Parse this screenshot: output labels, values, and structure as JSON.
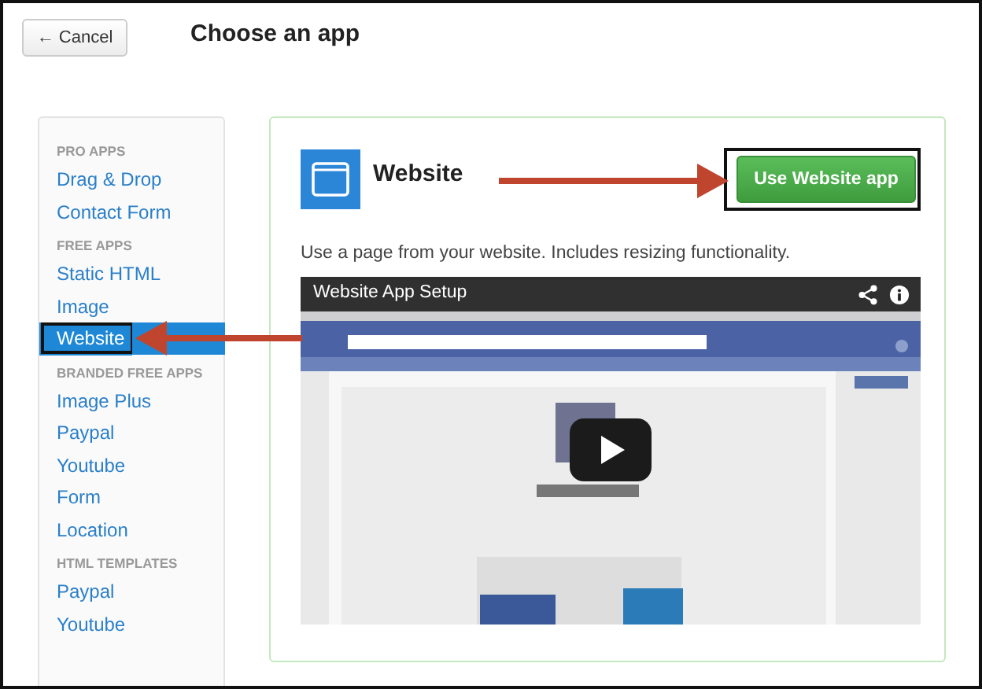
{
  "header": {
    "cancel_button": "← Cancel",
    "title": "Choose an app"
  },
  "sidebar": {
    "sections": [
      {
        "heading": "PRO APPS",
        "items": [
          {
            "label": "Drag & Drop",
            "selected": false
          },
          {
            "label": "Contact Form",
            "selected": false
          }
        ]
      },
      {
        "heading": "FREE APPS",
        "items": [
          {
            "label": "Static HTML",
            "selected": false
          },
          {
            "label": "Image",
            "selected": false
          },
          {
            "label": "Website",
            "selected": true
          }
        ]
      },
      {
        "heading": "BRANDED FREE APPS",
        "items": [
          {
            "label": "Image Plus",
            "selected": false
          },
          {
            "label": "Paypal",
            "selected": false
          },
          {
            "label": "Youtube",
            "selected": false
          },
          {
            "label": "Form",
            "selected": false
          },
          {
            "label": "Location",
            "selected": false
          }
        ]
      },
      {
        "heading": "HTML TEMPLATES",
        "items": [
          {
            "label": "Paypal",
            "selected": false
          },
          {
            "label": "Youtube",
            "selected": false
          }
        ]
      }
    ]
  },
  "app": {
    "name": "Website",
    "use_button": "Use Website app",
    "description": "Use a page from your website. Includes resizing functionality.",
    "video": {
      "title": "Website App Setup",
      "kind": "picture"
    }
  }
}
